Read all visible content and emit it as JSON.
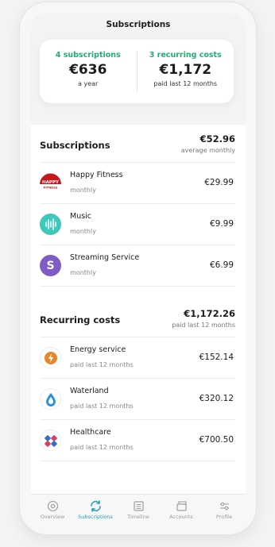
{
  "header": {
    "title": "Subscriptions"
  },
  "summary": {
    "left": {
      "label": "4 subscriptions",
      "value": "€636",
      "sub": "a year"
    },
    "right": {
      "label": "3 recurring costs",
      "value": "€1,172",
      "sub": "paid last 12 months"
    }
  },
  "subscriptions": {
    "title": "Subscriptions",
    "amount": "€52.96",
    "note": "average monthly",
    "items": [
      {
        "name": "Happy Fitness",
        "sub": "monthly",
        "amount": "€29.99",
        "icon": "happy-fitness-logo",
        "logo_text": "HAPPY",
        "logo_subtext": "FITNESS"
      },
      {
        "name": "Music",
        "sub": "monthly",
        "amount": "€9.99",
        "icon": "music-logo"
      },
      {
        "name": "Streaming Service",
        "sub": "monthly",
        "amount": "€6.99",
        "icon": "streaming-logo",
        "logo_text": "S"
      }
    ]
  },
  "recurring": {
    "title": "Recurring costs",
    "amount": "€1,172.26",
    "note": "paid last 12 months",
    "items": [
      {
        "name": "Energy service",
        "sub": "paid last 12 months",
        "amount": "€152.14",
        "icon": "energy-bolt-icon"
      },
      {
        "name": "Waterland",
        "sub": "paid last 12 months",
        "amount": "€320.12",
        "icon": "water-drop-icon"
      },
      {
        "name": "Healthcare",
        "sub": "paid last 12 months",
        "amount": "€700.50",
        "icon": "healthcare-logo"
      }
    ]
  },
  "tabs": [
    {
      "label": "Overview",
      "icon": "overview-icon",
      "active": false
    },
    {
      "label": "Subscriptions",
      "icon": "sync-icon",
      "active": true
    },
    {
      "label": "Timeline",
      "icon": "timeline-icon",
      "active": false
    },
    {
      "label": "Accounts",
      "icon": "accounts-icon",
      "active": false
    },
    {
      "label": "Profile",
      "icon": "profile-sliders-icon",
      "active": false
    }
  ],
  "colors": {
    "accent_green": "#1fae72",
    "active_tab": "#1fa3b5",
    "happy_fitness_red": "#c8161d",
    "music_teal": "#3ec8b9",
    "streaming_purple": "#7e5cc6",
    "energy_orange": "#e8862a",
    "water_blue": "#2e8ee0"
  }
}
